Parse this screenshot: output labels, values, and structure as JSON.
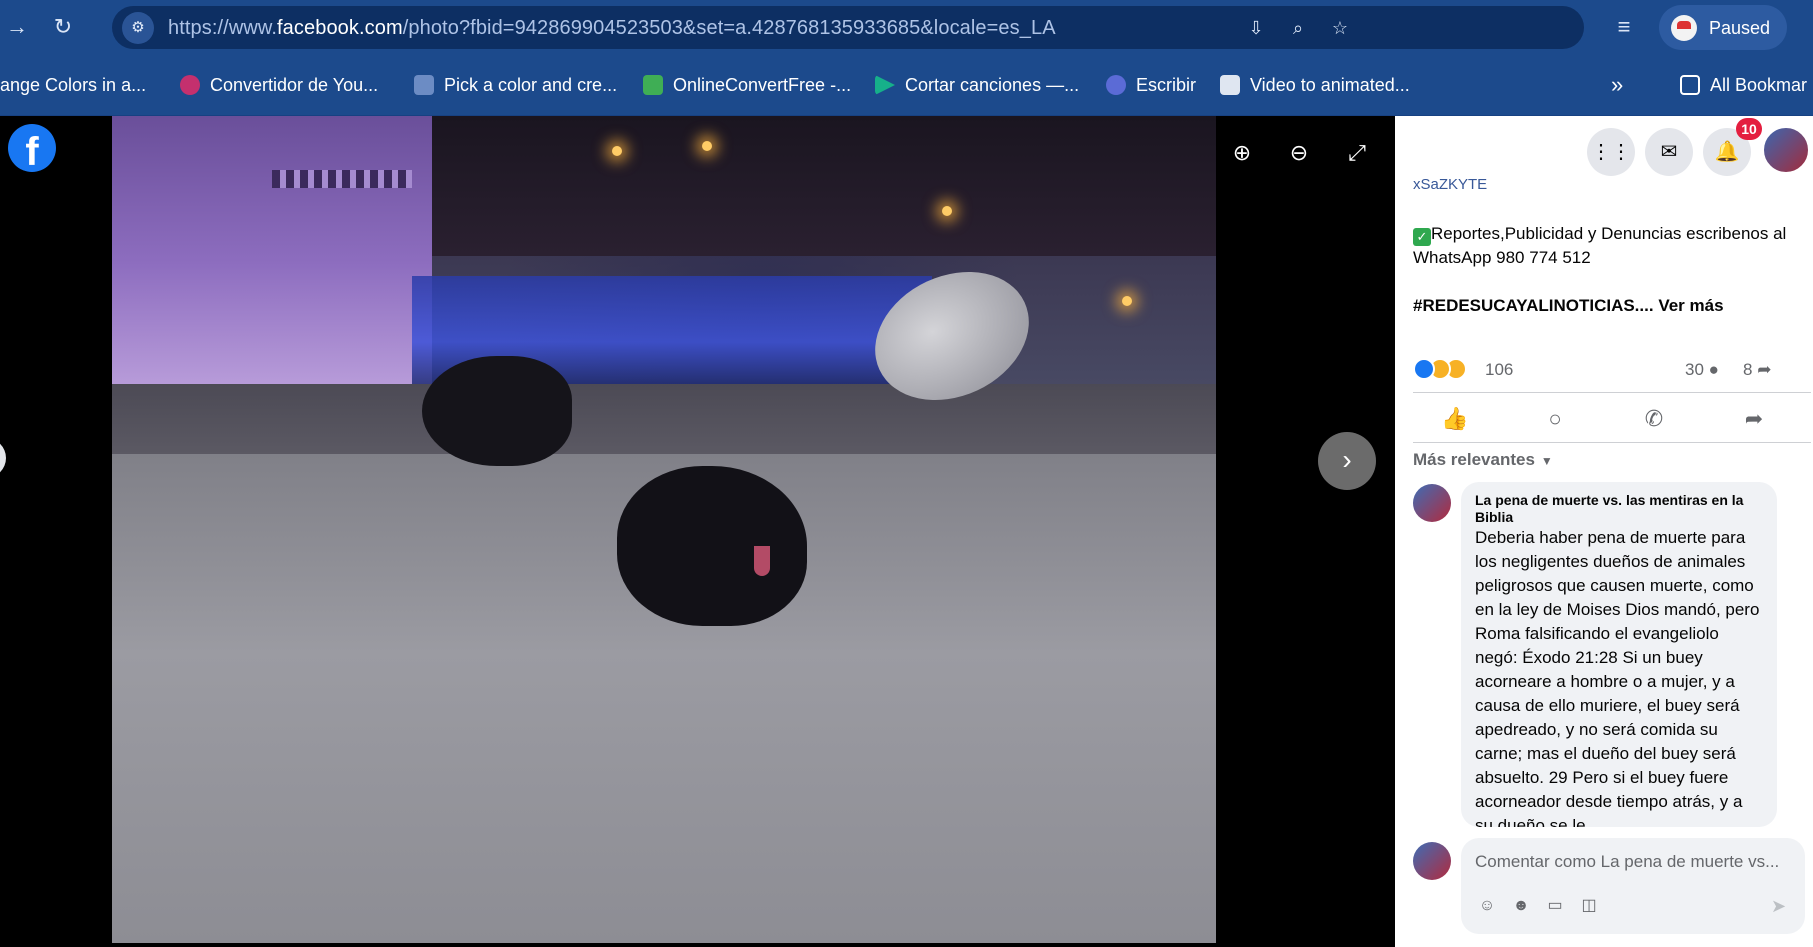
{
  "browser": {
    "url_prefix": "https://www.",
    "url_host": "facebook.com",
    "url_path": "/photo?fbid=942869904523503&set=a.428768135933685&locale=es_LA",
    "profile_status": "Paused",
    "bookmarks": [
      "ange Colors in a...",
      "Convertidor de You...",
      "Pick a color and cre...",
      "OnlineConvertFree -...",
      "Cortar canciones —...",
      "Escribir",
      "Video to animated..."
    ],
    "more_bookmarks": "»",
    "all_bookmarks": "All Bookmar"
  },
  "viewer": {
    "logo": "f",
    "next_glyph": "›"
  },
  "panel": {
    "notifications_badge": "10",
    "link_fragment": "xSaZKYTE",
    "post_body": "Reportes,Publicidad y Denuncias escribenos al WhatsApp 980 774 512",
    "hashtag": "#REDESUCAYALINOTICIAS....",
    "see_more": "Ver más",
    "reactions_count": "106",
    "comments_count": "30",
    "shares_count": "8",
    "sort_label": "Más relevantes",
    "comment": {
      "author": "La pena de muerte vs. las mentiras en la Biblia",
      "text": "Deberia haber pena de muerte para los negligentes dueños de animales peligrosos que causen muerte, como en la ley de Moises Dios mandó, pero Roma falsificando el evangeliolo negó: Éxodo 21:28 Si un buey acorneare a hombre o a mujer, y a causa de ello muriere, el buey será apedreado, y no será comida su carne; mas el dueño del buey será absuelto. 29 Pero si el buey fuere acorneador desde tiempo atrás, y a su dueño se le"
    },
    "composer_placeholder": "Comentar como La pena de muerte vs..."
  },
  "colors": {
    "chrome": "#1c4a8c",
    "facebook_blue": "#1877f2",
    "badge_red": "#e41e3f"
  }
}
